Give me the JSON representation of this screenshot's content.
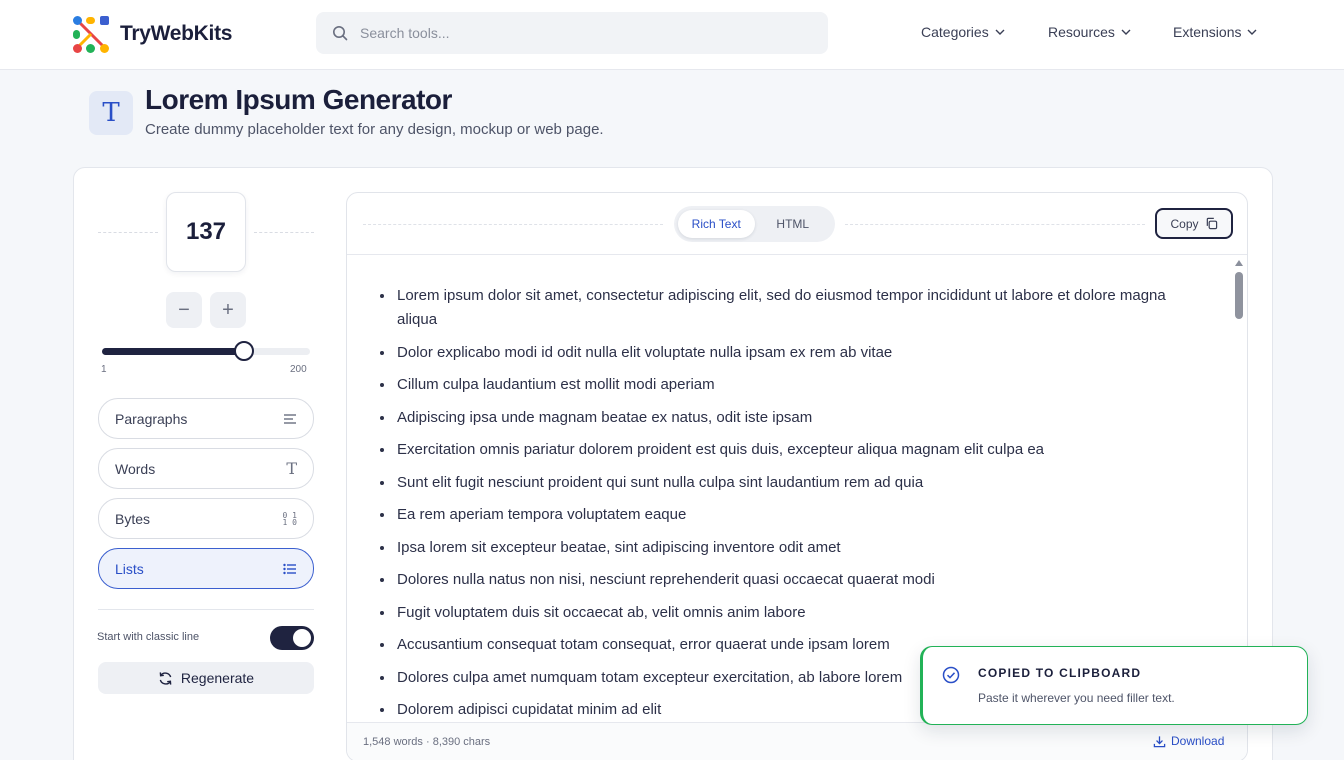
{
  "brand": {
    "name": "TryWebKits"
  },
  "search": {
    "placeholder": "Search tools..."
  },
  "nav": [
    {
      "label": "Categories"
    },
    {
      "label": "Resources"
    },
    {
      "label": "Extensions"
    }
  ],
  "page": {
    "title": "Lorem Ipsum Generator",
    "subtitle": "Create dummy placeholder text for any design, mockup or web page."
  },
  "controls": {
    "count": "137",
    "decrement": "−",
    "increment": "+",
    "slider": {
      "min": "1",
      "max": "200",
      "value": 137
    },
    "modes": [
      {
        "label": "Paragraphs",
        "icon": "align-left-icon",
        "active": false
      },
      {
        "label": "Words",
        "icon": "type-icon",
        "active": false
      },
      {
        "label": "Bytes",
        "icon": "binary-icon",
        "active": false
      },
      {
        "label": "Lists",
        "icon": "list-icon",
        "active": true
      }
    ],
    "classic_line_label": "Start with classic line",
    "classic_line_on": true,
    "regenerate_label": "Regenerate"
  },
  "output": {
    "tabs": [
      {
        "label": "Rich Text",
        "active": true
      },
      {
        "label": "HTML",
        "active": false
      }
    ],
    "copy_label": "Copy",
    "items": [
      "Lorem ipsum dolor sit amet, consectetur adipiscing elit, sed do eiusmod tempor incididunt ut labore et dolore magna aliqua",
      "Dolor explicabo modi id odit nulla elit voluptate nulla ipsam ex rem ab vitae",
      "Cillum culpa laudantium est mollit modi aperiam",
      "Adipiscing ipsa unde magnam beatae ex natus, odit iste ipsam",
      "Exercitation omnis pariatur dolorem proident est quis duis, excepteur aliqua magnam elit culpa ea",
      "Sunt elit fugit nesciunt proident qui sunt nulla culpa sint laudantium rem ad quia",
      "Ea rem aperiam tempora voluptatem eaque",
      "Ipsa lorem sit excepteur beatae, sint adipiscing inventore odit amet",
      "Dolores nulla natus non nisi, nesciunt reprehenderit quasi occaecat quaerat modi",
      "Fugit voluptatem duis sit occaecat ab, velit omnis anim labore",
      "Accusantium consequat totam consequat, error quaerat unde ipsam lorem",
      "Dolores culpa amet numquam totam excepteur exercitation, ab labore lorem",
      "Dolorem adipisci cupidatat minim ad elit"
    ],
    "stats": "1,548 words · 8,390 chars",
    "download_label": "Download"
  },
  "toast": {
    "title": "COPIED TO CLIPBOARD",
    "message": "Paste it wherever you need filler text."
  },
  "colors": {
    "accent": "#2a4fc7",
    "dark": "#1f2340",
    "success": "#22b257"
  }
}
